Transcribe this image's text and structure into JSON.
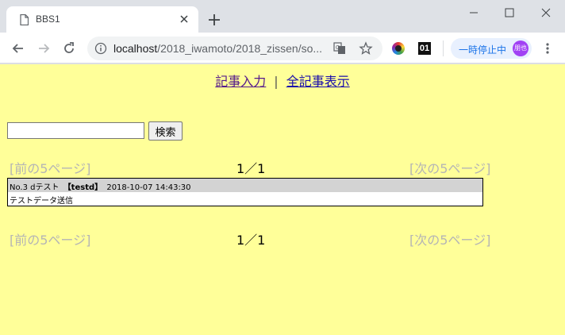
{
  "browser": {
    "tab_title": "BBS1",
    "url_host": "localhost",
    "url_path": "/2018_iwamoto/2018_zissen/so...",
    "paused_label": "一時停止中",
    "profile_initials": "朋也",
    "extension_badge": "01"
  },
  "page": {
    "nav": {
      "entry_link": "記事入力",
      "separator": "|",
      "show_all_link": "全記事表示"
    },
    "search": {
      "input_value": "",
      "button_label": "検索"
    },
    "pager": {
      "prev_label": "[前の5ページ]",
      "page_indicator": "1／1",
      "next_label": "[次の5ページ]"
    },
    "posts": [
      {
        "number_title": "No.3 dテスト",
        "user": "【testd】",
        "timestamp": "2018-10-07 14:43:30",
        "body": "テストデータ送信"
      }
    ]
  }
}
